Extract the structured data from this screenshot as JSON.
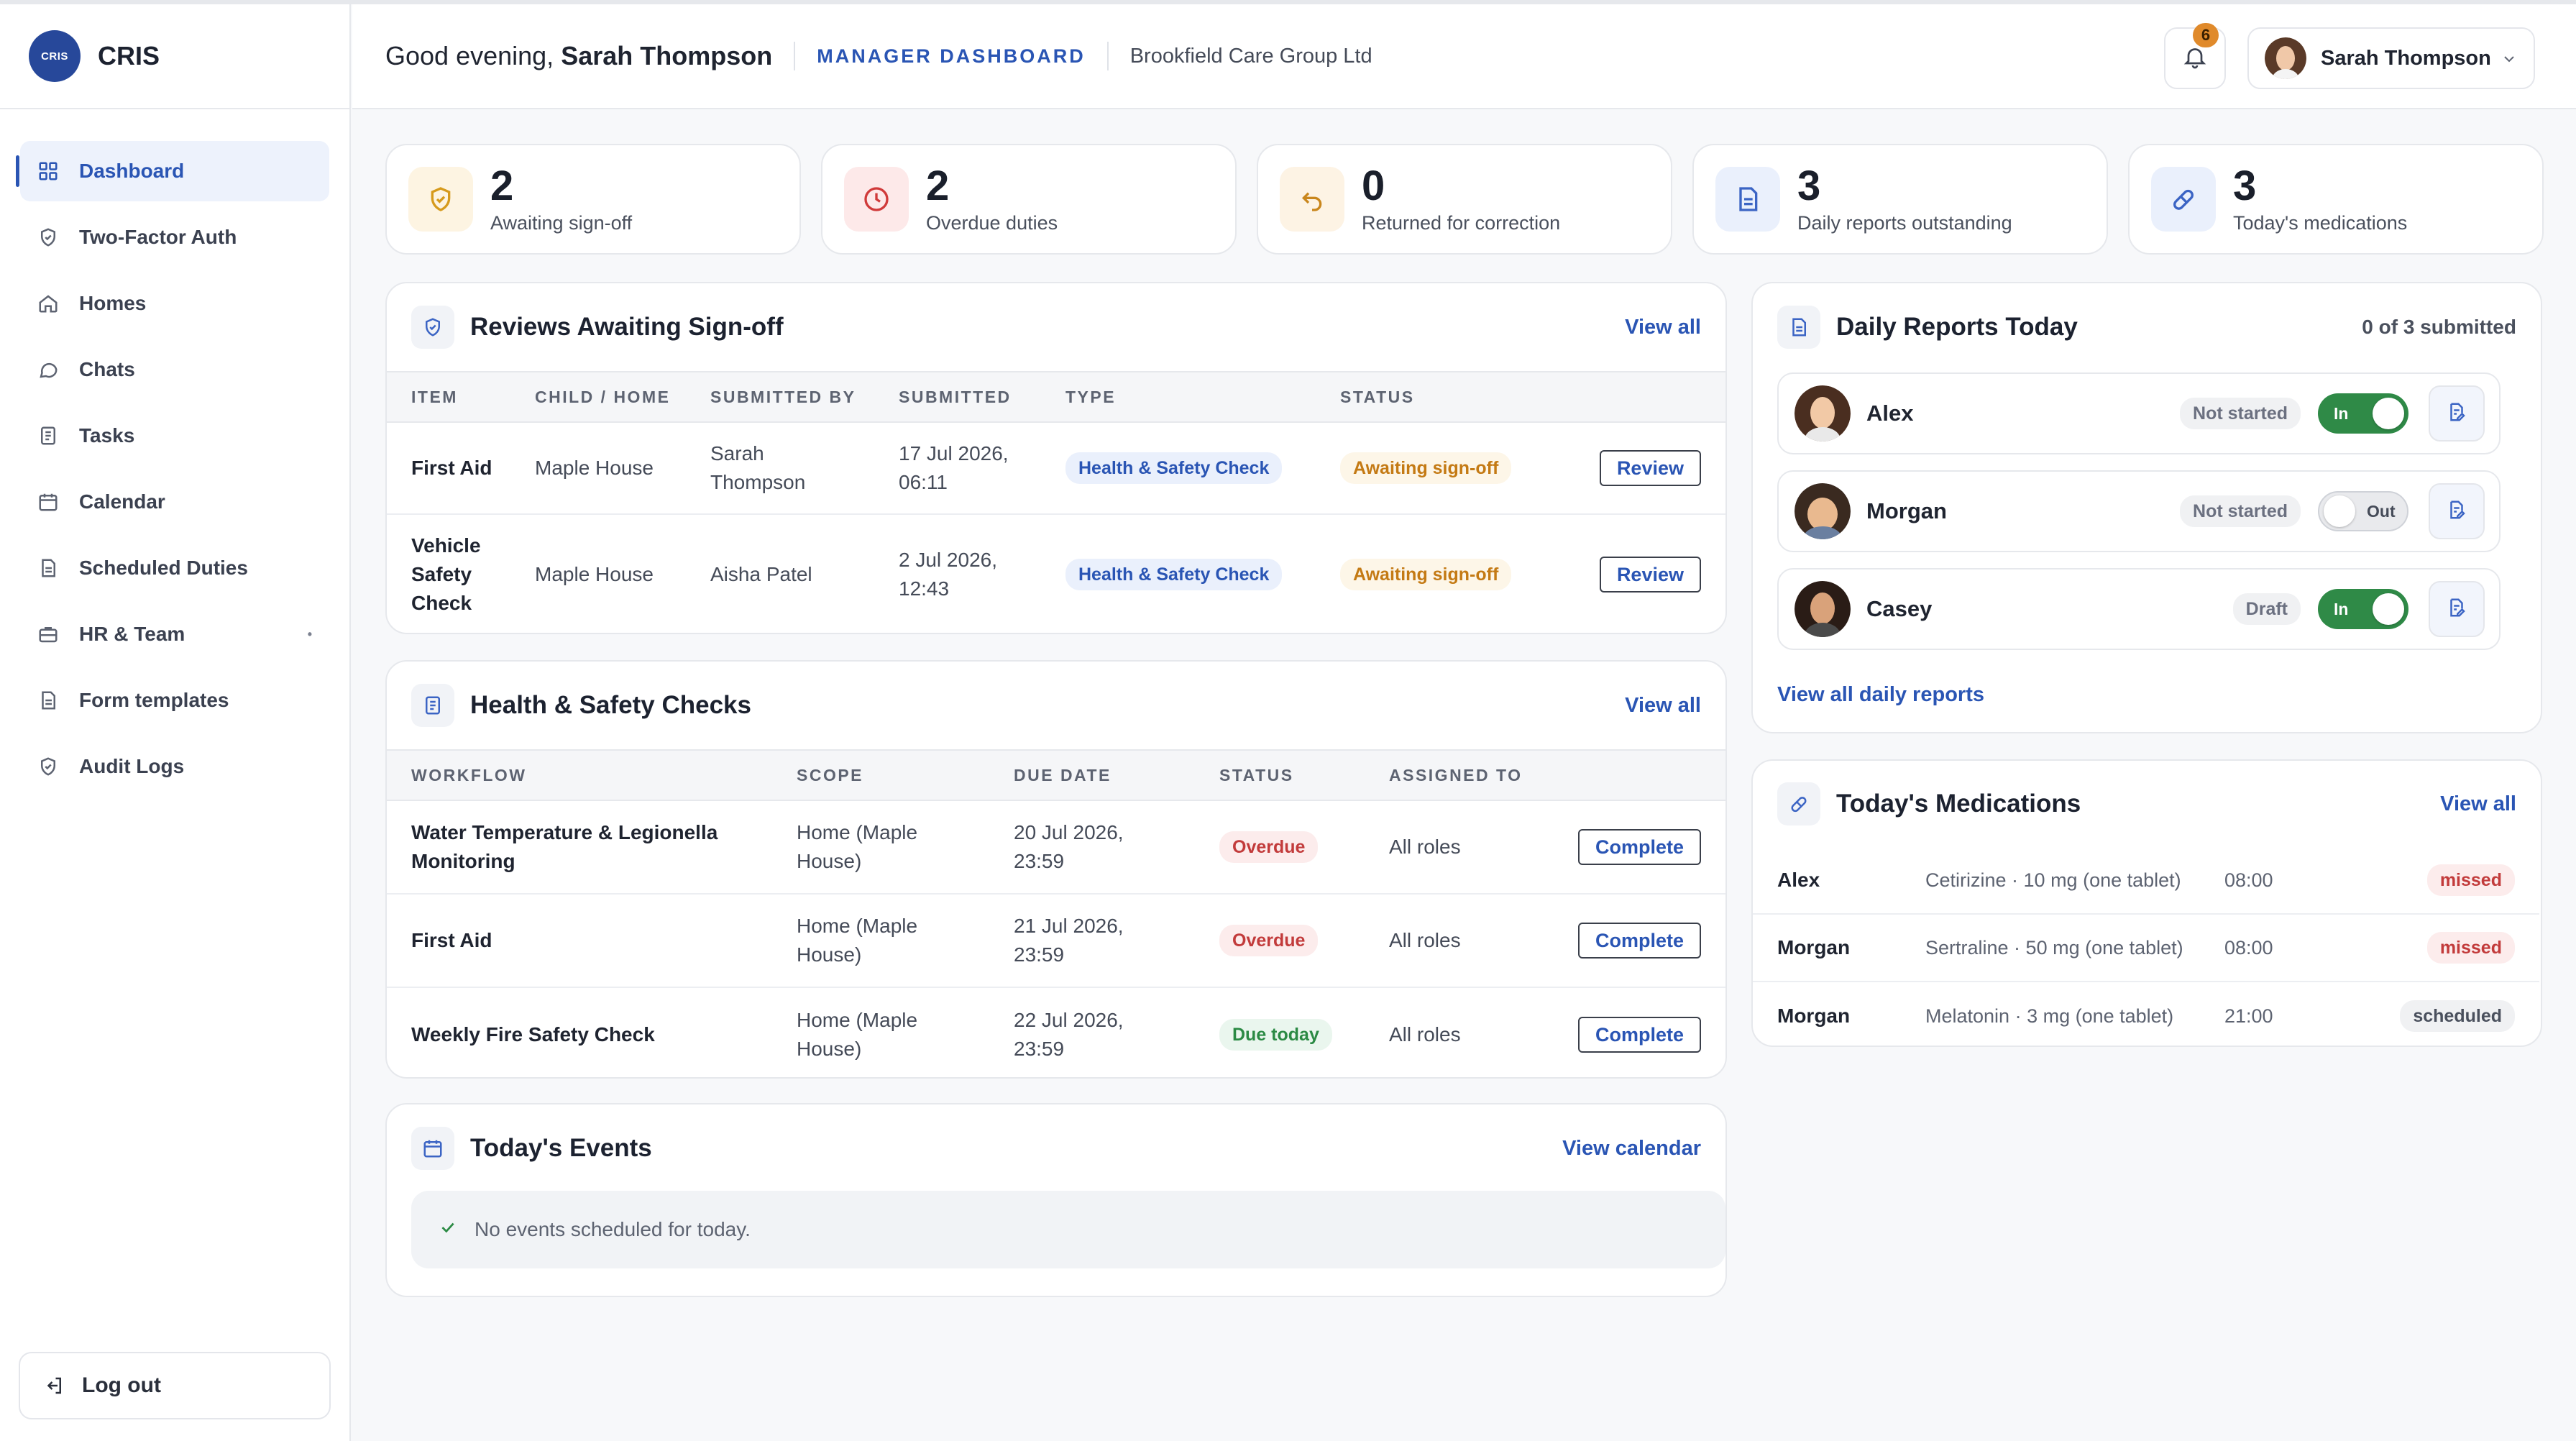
{
  "brand": {
    "logo_text": "CRIS",
    "name": "CRIS"
  },
  "sidebar": {
    "items": [
      {
        "label": "Dashboard",
        "icon": "grid-icon"
      },
      {
        "label": "Two-Factor Auth",
        "icon": "shield-icon"
      },
      {
        "label": "Homes",
        "icon": "home-icon"
      },
      {
        "label": "Chats",
        "icon": "chat-icon"
      },
      {
        "label": "Tasks",
        "icon": "document-icon"
      },
      {
        "label": "Calendar",
        "icon": "calendar-icon"
      },
      {
        "label": "Scheduled Duties",
        "icon": "document-icon"
      },
      {
        "label": "HR & Team",
        "icon": "briefcase-icon"
      },
      {
        "label": "Form templates",
        "icon": "document-icon"
      },
      {
        "label": "Audit Logs",
        "icon": "shield-icon"
      }
    ],
    "logout_label": "Log out"
  },
  "header": {
    "greeting_prefix": "Good evening, ",
    "greeting_name": "Sarah Thompson",
    "role": "MANAGER DASHBOARD",
    "org": "Brookfield Care Group Ltd",
    "notification_count": "6",
    "user_name": "Sarah Thompson"
  },
  "stats": [
    {
      "value": "2",
      "label": "Awaiting sign-off",
      "color": "#d69a1c"
    },
    {
      "value": "2",
      "label": "Overdue duties",
      "color": "#d03a3a"
    },
    {
      "value": "0",
      "label": "Returned for correction",
      "color": "#c9861c"
    },
    {
      "value": "3",
      "label": "Daily reports outstanding",
      "color": "#3b64c4"
    },
    {
      "value": "3",
      "label": "Today's medications",
      "color": "#3b64c4"
    }
  ],
  "reviews": {
    "title": "Reviews Awaiting Sign-off",
    "link": "View all",
    "columns": [
      "ITEM",
      "CHILD / HOME",
      "SUBMITTED BY",
      "SUBMITTED",
      "TYPE",
      "STATUS"
    ],
    "rows": [
      {
        "item": "First Aid",
        "home": "Maple House",
        "by": "Sarah Thompson",
        "submitted": "17 Jul 2026, 06:11",
        "type": "Health & Safety Check",
        "status": "Awaiting sign-off",
        "action": "Review"
      },
      {
        "item": "Vehicle Safety Check",
        "home": "Maple House",
        "by": "Aisha Patel",
        "submitted": "2 Jul 2026, 12:43",
        "type": "Health & Safety Check",
        "status": "Awaiting sign-off",
        "action": "Review"
      }
    ]
  },
  "checks": {
    "title": "Health & Safety Checks",
    "link": "View all",
    "columns": [
      "WORKFLOW",
      "SCOPE",
      "DUE DATE",
      "STATUS",
      "ASSIGNED TO"
    ],
    "rows": [
      {
        "workflow": "Water Temperature & Legionella Monitoring",
        "scope": "Home (Maple House)",
        "due": "20 Jul 2026, 23:59",
        "status": "Overdue",
        "assigned": "All roles",
        "action": "Complete"
      },
      {
        "workflow": "First Aid",
        "scope": "Home (Maple House)",
        "due": "21 Jul 2026, 23:59",
        "status": "Overdue",
        "assigned": "All roles",
        "action": "Complete"
      },
      {
        "workflow": "Weekly Fire Safety Check",
        "scope": "Home (Maple House)",
        "due": "22 Jul 2026, 23:59",
        "status": "Due today",
        "assigned": "All roles",
        "action": "Complete"
      }
    ]
  },
  "events": {
    "title": "Today's Events",
    "link": "View calendar",
    "empty": "No events scheduled for today."
  },
  "daily_reports": {
    "title": "Daily Reports Today",
    "meta": "0 of 3 submitted",
    "link": "View all daily reports",
    "rows": [
      {
        "name": "Alex",
        "status": "Not started",
        "toggle": "In",
        "on": true
      },
      {
        "name": "Morgan",
        "status": "Not started",
        "toggle": "Out",
        "on": false
      },
      {
        "name": "Casey",
        "status": "Draft",
        "toggle": "In",
        "on": true
      }
    ]
  },
  "medications": {
    "title": "Today's Medications",
    "link": "View all",
    "rows": [
      {
        "name": "Alex",
        "drug": "Cetirizine · 10 mg (one tablet)",
        "time": "08:00",
        "status": "missed"
      },
      {
        "name": "Morgan",
        "drug": "Sertraline · 50 mg (one tablet)",
        "time": "08:00",
        "status": "missed"
      },
      {
        "name": "Morgan",
        "drug": "Melatonin · 3 mg (one tablet)",
        "time": "21:00",
        "status": "scheduled"
      }
    ]
  }
}
